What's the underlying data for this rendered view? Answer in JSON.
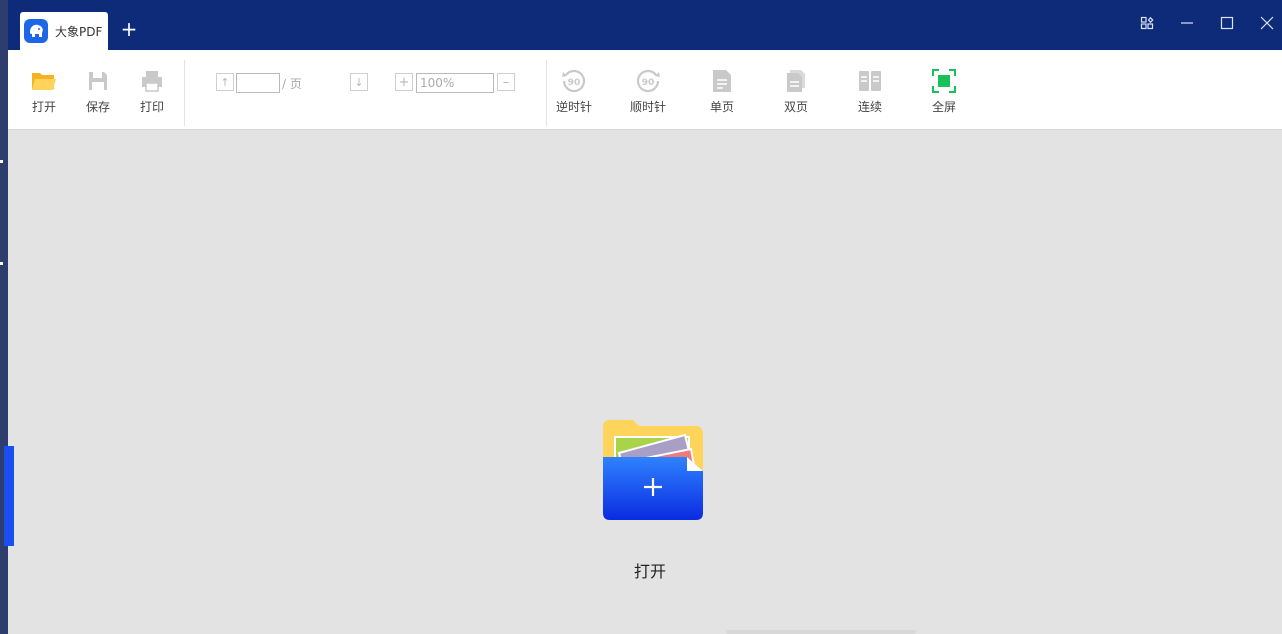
{
  "app": {
    "tab_title": "大象PDF",
    "new_tab": "+"
  },
  "window_controls": [
    "layout-icon",
    "minimize-icon",
    "maximize-icon",
    "close-icon"
  ],
  "toolbar": {
    "open": "打开",
    "save": "保存",
    "print": "打印",
    "page_input_value": "",
    "page_suffix": "/ 页",
    "zoom_value": "100%",
    "rotate_ccw": "逆时针",
    "rotate_ccw_badge": "90",
    "rotate_cw": "顺时针",
    "rotate_cw_badge": "90",
    "single_page": "单页",
    "double_page": "双页",
    "continuous": "连续",
    "fullscreen": "全屏"
  },
  "content": {
    "open_label": "打开"
  },
  "colors": {
    "titlebar": "#0d2b78",
    "accent": "#1e66e8",
    "fullscreen": "#19c15a",
    "folder": "#ffd45a"
  }
}
